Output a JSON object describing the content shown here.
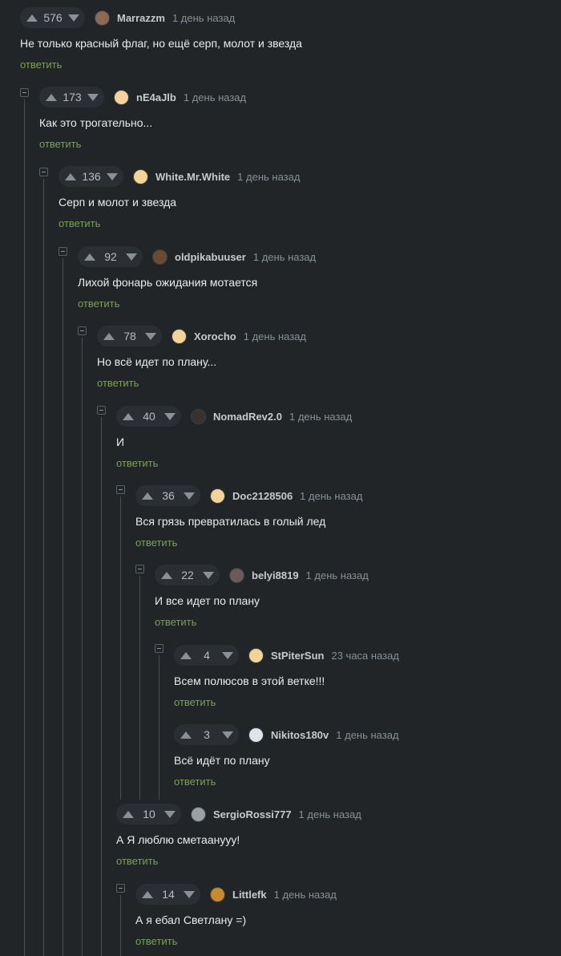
{
  "reply_label": "ответить",
  "comments": [
    {
      "score": "576",
      "username": "Marrazzm",
      "time": "1 день назад",
      "text": "Не только красный флаг, но ещё серп, молот и звезда",
      "avatar_color": "#8a6a55"
    },
    {
      "score": "173",
      "username": "nE4aJlb",
      "time": "1 день назад",
      "text": "Как это трогательно...",
      "avatar_color": "#f2d49a"
    },
    {
      "score": "136",
      "username": "White.Mr.White",
      "time": "1 день назад",
      "text": "Серп и молот и звезда",
      "avatar_color": "#f2d49a"
    },
    {
      "score": "92",
      "username": "oldpikabuuser",
      "time": "1 день назад",
      "text": "Лихой фонарь ожидания мотается",
      "avatar_color": "#6b4a32"
    },
    {
      "score": "78",
      "username": "Xorocho",
      "time": "1 день назад",
      "text": "Но всё идет по плану...",
      "avatar_color": "#f2d49a"
    },
    {
      "score": "40",
      "username": "NomadRev2.0",
      "time": "1 день назад",
      "text": "И",
      "avatar_color": "#3a3230"
    },
    {
      "score": "36",
      "username": "Doc2128506",
      "time": "1 день назад",
      "text": "Вся грязь превратилась в голый лед",
      "avatar_color": "#f2d49a"
    },
    {
      "score": "22",
      "username": "belyi8819",
      "time": "1 день назад",
      "text": "И все идет по плану",
      "avatar_color": "#6a5a58"
    },
    {
      "score": "4",
      "username": "StPiterSun",
      "time": "23 часа назад",
      "text": "Всем полюсов в этой ветке!!!",
      "avatar_color": "#f2d49a"
    },
    {
      "score": "3",
      "username": "Nikitos180v",
      "time": "1 день назад",
      "text": "Всё идёт по плану",
      "avatar_color": "#dfe3ea"
    },
    {
      "score": "10",
      "username": "SergioRossi777",
      "time": "1 день назад",
      "text": "А Я люблю сметаанууу!",
      "avatar_color": "#9aa0a4"
    },
    {
      "score": "14",
      "username": "Littlefk",
      "time": "1 день назад",
      "text": "А я ебал Светлану =)",
      "avatar_color": "#c98a2e"
    }
  ]
}
